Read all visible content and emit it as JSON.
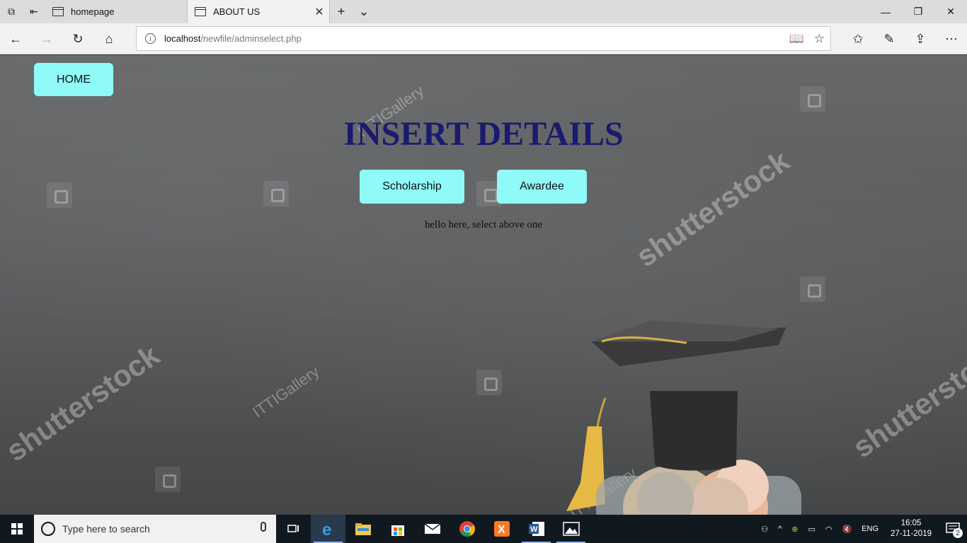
{
  "browser": {
    "tabs": [
      {
        "title": "homepage",
        "active": false
      },
      {
        "title": "ABOUT US",
        "active": true
      }
    ],
    "url_host": "localhost",
    "url_path": "/newfile/adminselect.php"
  },
  "page": {
    "home_label": "HOME",
    "heading": "INSERT DETAILS",
    "buttons": {
      "scholarship": "Scholarship",
      "awardee": "Awardee"
    },
    "message": "hello here, select above one",
    "watermarks": {
      "brand": "shutterstock",
      "gallery": "ITTIGallery"
    }
  },
  "taskbar": {
    "search_placeholder": "Type here to search",
    "language": "ENG",
    "time": "16:05",
    "date": "27-11-2019",
    "notification_count": "2"
  },
  "colors": {
    "button_bg": "#8ffaf8",
    "heading": "#1a1a6e",
    "taskbar": "#101820"
  }
}
